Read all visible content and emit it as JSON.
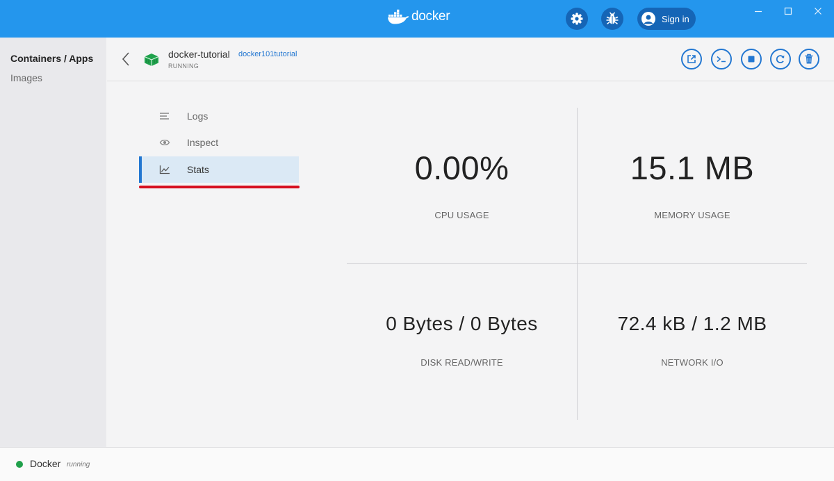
{
  "app": {
    "logo_text": "docker",
    "sign_in": "Sign in",
    "accent": "#2496ed"
  },
  "sidebar": {
    "items": [
      {
        "label": "Containers / Apps"
      },
      {
        "label": "Images"
      }
    ]
  },
  "container": {
    "name": "docker-tutorial",
    "image": "docker101tutorial",
    "status": "RUNNING"
  },
  "tabs": [
    {
      "label": "Logs",
      "icon": "logs-icon"
    },
    {
      "label": "Inspect",
      "icon": "eye-icon"
    },
    {
      "label": "Stats",
      "icon": "chart-icon"
    }
  ],
  "stats": {
    "cpu": {
      "value": "0.00%",
      "label": "CPU USAGE"
    },
    "memory": {
      "value": "15.1 MB",
      "label": "MEMORY USAGE"
    },
    "disk": {
      "value": "0 Bytes / 0 Bytes",
      "label": "DISK READ/WRITE"
    },
    "network": {
      "value": "72.4 kB / 1.2 MB",
      "label": "NETWORK I/O"
    }
  },
  "footer": {
    "name": "Docker",
    "state": "running",
    "status_color": "#20a04b"
  }
}
